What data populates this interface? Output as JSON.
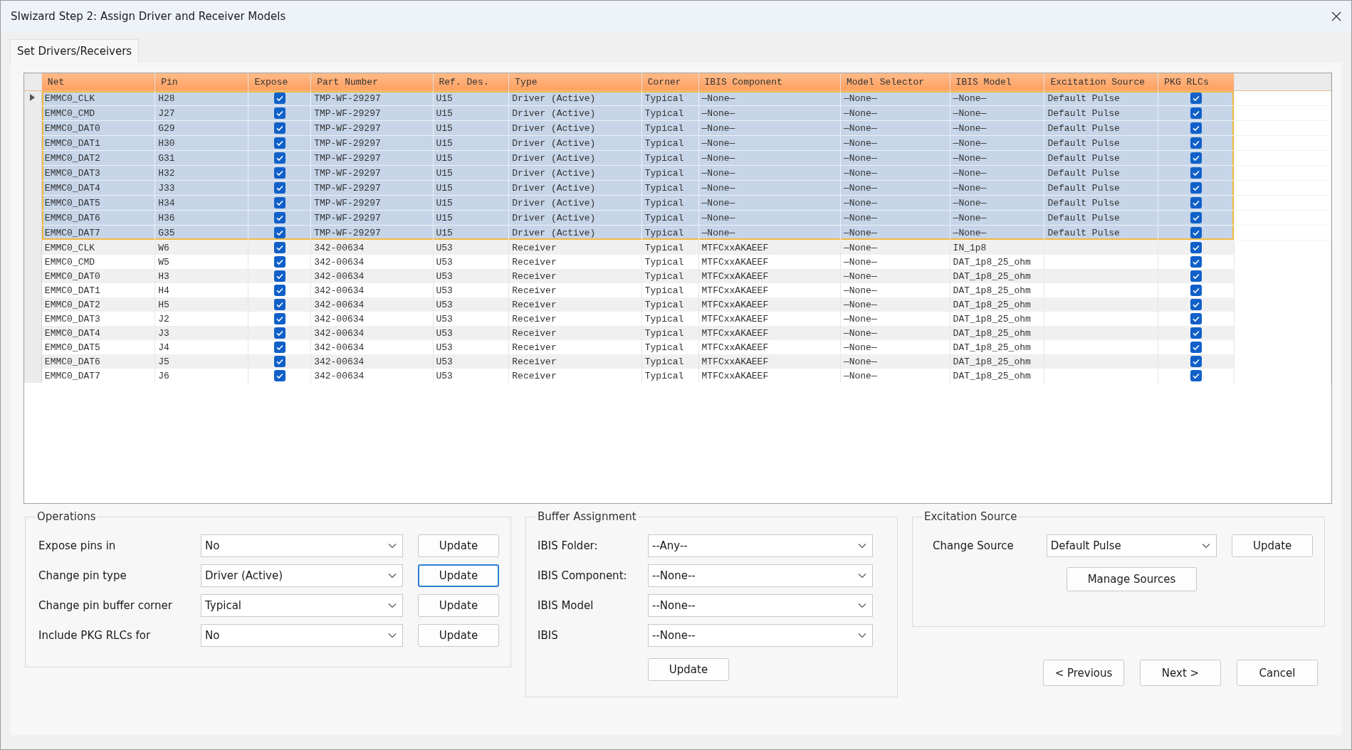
{
  "window": {
    "title": "SIwizard Step 2: Assign Driver and Receiver Models"
  },
  "tabs": [
    {
      "label": "Set Drivers/Receivers",
      "selected": true
    }
  ],
  "table": {
    "columns": [
      "Net",
      "Pin",
      "Expose",
      "Part Number",
      "Ref. Des.",
      "Type",
      "Corner",
      "IBIS Component",
      "Model Selector",
      "IBIS Model",
      "Excitation Source",
      "PKG RLCs"
    ],
    "rows": [
      {
        "net": "EMMC0_CLK",
        "pin": "H28",
        "expose": true,
        "part_number": "TMP-WF-29297",
        "ref_des": "U15",
        "type": "Driver (Active)",
        "corner": "Typical",
        "ibis_component": "—None—",
        "model_selector": "—None—",
        "ibis_model": "—None—",
        "excitation_source": "Default Pulse",
        "pkg_rlcs": true,
        "selected": true,
        "current": true
      },
      {
        "net": "EMMC0_CMD",
        "pin": "J27",
        "expose": true,
        "part_number": "TMP-WF-29297",
        "ref_des": "U15",
        "type": "Driver (Active)",
        "corner": "Typical",
        "ibis_component": "—None—",
        "model_selector": "—None—",
        "ibis_model": "—None—",
        "excitation_source": "Default Pulse",
        "pkg_rlcs": true,
        "selected": true,
        "current": false
      },
      {
        "net": "EMMC0_DAT0",
        "pin": "G29",
        "expose": true,
        "part_number": "TMP-WF-29297",
        "ref_des": "U15",
        "type": "Driver (Active)",
        "corner": "Typical",
        "ibis_component": "—None—",
        "model_selector": "—None—",
        "ibis_model": "—None—",
        "excitation_source": "Default Pulse",
        "pkg_rlcs": true,
        "selected": true,
        "current": false
      },
      {
        "net": "EMMC0_DAT1",
        "pin": "H30",
        "expose": true,
        "part_number": "TMP-WF-29297",
        "ref_des": "U15",
        "type": "Driver (Active)",
        "corner": "Typical",
        "ibis_component": "—None—",
        "model_selector": "—None—",
        "ibis_model": "—None—",
        "excitation_source": "Default Pulse",
        "pkg_rlcs": true,
        "selected": true,
        "current": false
      },
      {
        "net": "EMMC0_DAT2",
        "pin": "G31",
        "expose": true,
        "part_number": "TMP-WF-29297",
        "ref_des": "U15",
        "type": "Driver (Active)",
        "corner": "Typical",
        "ibis_component": "—None—",
        "model_selector": "—None—",
        "ibis_model": "—None—",
        "excitation_source": "Default Pulse",
        "pkg_rlcs": true,
        "selected": true,
        "current": false
      },
      {
        "net": "EMMC0_DAT3",
        "pin": "H32",
        "expose": true,
        "part_number": "TMP-WF-29297",
        "ref_des": "U15",
        "type": "Driver (Active)",
        "corner": "Typical",
        "ibis_component": "—None—",
        "model_selector": "—None—",
        "ibis_model": "—None—",
        "excitation_source": "Default Pulse",
        "pkg_rlcs": true,
        "selected": true,
        "current": false
      },
      {
        "net": "EMMC0_DAT4",
        "pin": "J33",
        "expose": true,
        "part_number": "TMP-WF-29297",
        "ref_des": "U15",
        "type": "Driver (Active)",
        "corner": "Typical",
        "ibis_component": "—None—",
        "model_selector": "—None—",
        "ibis_model": "—None—",
        "excitation_source": "Default Pulse",
        "pkg_rlcs": true,
        "selected": true,
        "current": false
      },
      {
        "net": "EMMC0_DAT5",
        "pin": "H34",
        "expose": true,
        "part_number": "TMP-WF-29297",
        "ref_des": "U15",
        "type": "Driver (Active)",
        "corner": "Typical",
        "ibis_component": "—None—",
        "model_selector": "—None—",
        "ibis_model": "—None—",
        "excitation_source": "Default Pulse",
        "pkg_rlcs": true,
        "selected": true,
        "current": false
      },
      {
        "net": "EMMC0_DAT6",
        "pin": "H36",
        "expose": true,
        "part_number": "TMP-WF-29297",
        "ref_des": "U15",
        "type": "Driver (Active)",
        "corner": "Typical",
        "ibis_component": "—None—",
        "model_selector": "—None—",
        "ibis_model": "—None—",
        "excitation_source": "Default Pulse",
        "pkg_rlcs": true,
        "selected": true,
        "current": false
      },
      {
        "net": "EMMC0_DAT7",
        "pin": "G35",
        "expose": true,
        "part_number": "TMP-WF-29297",
        "ref_des": "U15",
        "type": "Driver (Active)",
        "corner": "Typical",
        "ibis_component": "—None—",
        "model_selector": "—None—",
        "ibis_model": "—None—",
        "excitation_source": "Default Pulse",
        "pkg_rlcs": true,
        "selected": true,
        "current": false
      },
      {
        "net": "EMMC0_CLK",
        "pin": "W6",
        "expose": true,
        "part_number": "342-00634",
        "ref_des": "U53",
        "type": "Receiver",
        "corner": "Typical",
        "ibis_component": "MTFCxxAKAEEF",
        "model_selector": "—None—",
        "ibis_model": "IN_1p8",
        "pkg_rlcs": true,
        "selected": false,
        "current": false
      },
      {
        "net": "EMMC0_CMD",
        "pin": "W5",
        "expose": true,
        "part_number": "342-00634",
        "ref_des": "U53",
        "type": "Receiver",
        "corner": "Typical",
        "ibis_component": "MTFCxxAKAEEF",
        "model_selector": "—None—",
        "ibis_model": "DAT_1p8_25_ohm",
        "pkg_rlcs": true,
        "selected": false,
        "current": false
      },
      {
        "net": "EMMC0_DAT0",
        "pin": "H3",
        "expose": true,
        "part_number": "342-00634",
        "ref_des": "U53",
        "type": "Receiver",
        "corner": "Typical",
        "ibis_component": "MTFCxxAKAEEF",
        "model_selector": "—None—",
        "ibis_model": "DAT_1p8_25_ohm",
        "pkg_rlcs": true,
        "selected": false,
        "current": false
      },
      {
        "net": "EMMC0_DAT1",
        "pin": "H4",
        "expose": true,
        "part_number": "342-00634",
        "ref_des": "U53",
        "type": "Receiver",
        "corner": "Typical",
        "ibis_component": "MTFCxxAKAEEF",
        "model_selector": "—None—",
        "ibis_model": "DAT_1p8_25_ohm",
        "pkg_rlcs": true,
        "selected": false,
        "current": false
      },
      {
        "net": "EMMC0_DAT2",
        "pin": "H5",
        "expose": true,
        "part_number": "342-00634",
        "ref_des": "U53",
        "type": "Receiver",
        "corner": "Typical",
        "ibis_component": "MTFCxxAKAEEF",
        "model_selector": "—None—",
        "ibis_model": "DAT_1p8_25_ohm",
        "pkg_rlcs": true,
        "selected": false,
        "current": false
      },
      {
        "net": "EMMC0_DAT3",
        "pin": "J2",
        "expose": true,
        "part_number": "342-00634",
        "ref_des": "U53",
        "type": "Receiver",
        "corner": "Typical",
        "ibis_component": "MTFCxxAKAEEF",
        "model_selector": "—None—",
        "ibis_model": "DAT_1p8_25_ohm",
        "pkg_rlcs": true,
        "selected": false,
        "current": false
      },
      {
        "net": "EMMC0_DAT4",
        "pin": "J3",
        "expose": true,
        "part_number": "342-00634",
        "ref_des": "U53",
        "type": "Receiver",
        "corner": "Typical",
        "ibis_component": "MTFCxxAKAEEF",
        "model_selector": "—None—",
        "ibis_model": "DAT_1p8_25_ohm",
        "pkg_rlcs": true,
        "selected": false,
        "current": false
      },
      {
        "net": "EMMC0_DAT5",
        "pin": "J4",
        "expose": true,
        "part_number": "342-00634",
        "ref_des": "U53",
        "type": "Receiver",
        "corner": "Typical",
        "ibis_component": "MTFCxxAKAEEF",
        "model_selector": "—None—",
        "ibis_model": "DAT_1p8_25_ohm",
        "pkg_rlcs": true,
        "selected": false,
        "current": false
      },
      {
        "net": "EMMC0_DAT6",
        "pin": "J5",
        "expose": true,
        "part_number": "342-00634",
        "ref_des": "U53",
        "type": "Receiver",
        "corner": "Typical",
        "ibis_component": "MTFCxxAKAEEF",
        "model_selector": "—None—",
        "ibis_model": "DAT_1p8_25_ohm",
        "pkg_rlcs": true,
        "selected": false,
        "current": false
      },
      {
        "net": "EMMC0_DAT7",
        "pin": "J6",
        "expose": true,
        "part_number": "342-00634",
        "ref_des": "U53",
        "type": "Receiver",
        "corner": "Typical",
        "ibis_component": "MTFCxxAKAEEF",
        "model_selector": "—None—",
        "ibis_model": "DAT_1p8_25_ohm",
        "pkg_rlcs": true,
        "selected": false,
        "current": false
      }
    ]
  },
  "operations": {
    "title": "Operations",
    "rows": [
      {
        "label": "Expose pins in",
        "value": "No",
        "button": "Update",
        "focused": false
      },
      {
        "label": "Change pin type",
        "value": "Driver (Active)",
        "button": "Update",
        "focused": true
      },
      {
        "label": "Change pin buffer corner",
        "value": "Typical",
        "button": "Update",
        "focused": false
      },
      {
        "label": "Include PKG RLCs for",
        "value": "No",
        "button": "Update",
        "focused": false
      }
    ]
  },
  "buffer_assignment": {
    "title": "Buffer Assignment",
    "rows": [
      {
        "label": "IBIS Folder:",
        "value": "--Any--"
      },
      {
        "label": "IBIS Component:",
        "value": "--None--"
      },
      {
        "label": "IBIS Model",
        "value": "--None--"
      },
      {
        "label": "IBIS",
        "value": "--None--"
      }
    ],
    "button": "Update"
  },
  "excitation_source": {
    "title": "Excitation Source",
    "label": "Change Source",
    "value": "Default Pulse",
    "button": "Update",
    "manage_button": "Manage Sources"
  },
  "buttons": [
    "< Previous",
    "Next >",
    "Cancel"
  ]
}
